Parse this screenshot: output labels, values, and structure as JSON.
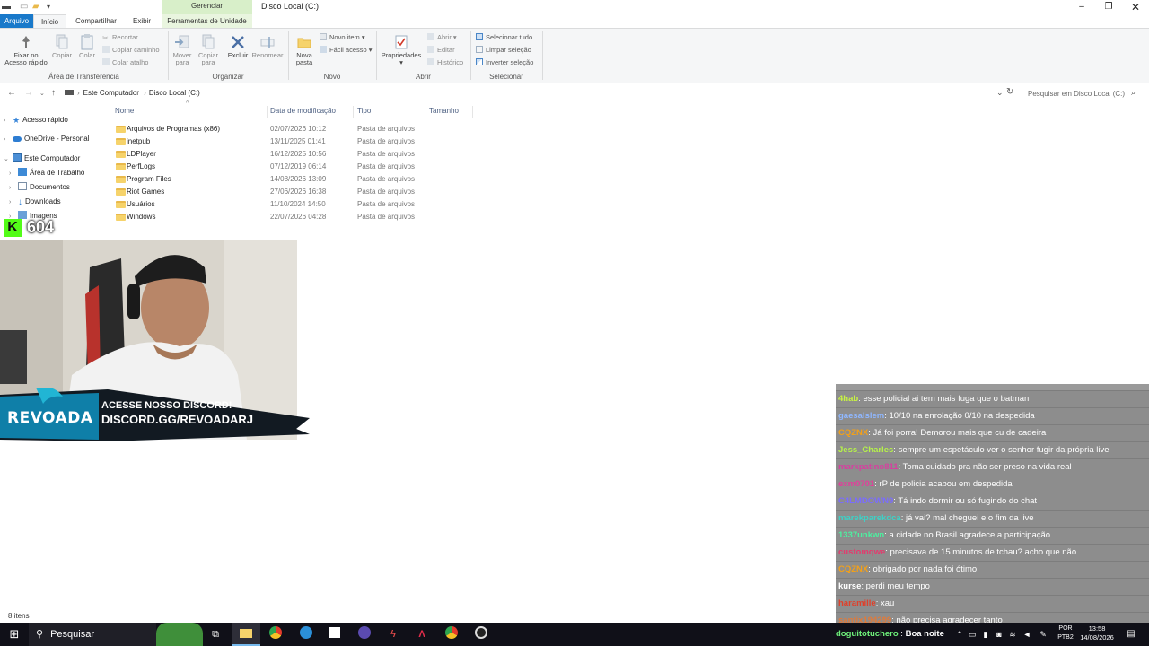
{
  "window": {
    "title": "Disco Local (C:)",
    "context_group": "Gerenciar"
  },
  "ribbon_tabs": [
    "Arquivo",
    "Início",
    "Compartilhar",
    "Exibir",
    "Ferramentas de Unidade"
  ],
  "ribbon": {
    "pin_label_1": "Fixar no",
    "pin_label_2": "Acesso rápido",
    "copy": "Copiar",
    "paste": "Colar",
    "cut": "Recortar",
    "copy_path": "Copiar caminho",
    "paste_shortcut": "Colar atalho",
    "move_to_1": "Mover",
    "move_to_2": "para",
    "copy_to_1": "Copiar",
    "copy_to_2": "para",
    "delete": "Excluir",
    "rename": "Renomear",
    "new_folder_1": "Nova",
    "new_folder_2": "pasta",
    "new_item": "Novo item",
    "easy_access": "Fácil acesso",
    "properties": "Propriedades",
    "open": "Abrir",
    "edit": "Editar",
    "history": "Histórico",
    "select_all": "Selecionar tudo",
    "select_none": "Limpar seleção",
    "invert_selection": "Inverter seleção",
    "groups": {
      "clipboard": "Área de Transferência",
      "organize": "Organizar",
      "new": "Novo",
      "open": "Abrir",
      "select": "Selecionar"
    }
  },
  "address": {
    "crumbs": [
      "Este Computador",
      "Disco Local (C:)"
    ],
    "separator": "›",
    "search_placeholder": "Pesquisar em Disco Local (C:)"
  },
  "nav_pane": {
    "quick_access": "Acesso rápido",
    "onedrive": "OneDrive - Personal",
    "this_pc": "Este Computador",
    "desktop": "Área de Trabalho",
    "documents": "Documentos",
    "downloads": "Downloads",
    "images": "Imagens"
  },
  "columns": {
    "name": "Nome",
    "modified": "Data de modificação",
    "type": "Tipo",
    "size": "Tamanho"
  },
  "files": [
    {
      "name": "Arquivos de Programas (x86)",
      "date": "02/07/2026 10:12",
      "type": "Pasta de arquivos"
    },
    {
      "name": "inetpub",
      "date": "13/11/2025 01:41",
      "type": "Pasta de arquivos"
    },
    {
      "name": "LDPlayer",
      "date": "16/12/2025 10:56",
      "type": "Pasta de arquivos"
    },
    {
      "name": "PerfLogs",
      "date": "07/12/2019 06:14",
      "type": "Pasta de arquivos"
    },
    {
      "name": "Program Files",
      "date": "14/08/2026 13:09",
      "type": "Pasta de arquivos"
    },
    {
      "name": "Riot Games",
      "date": "27/06/2026 16:38",
      "type": "Pasta de arquivos"
    },
    {
      "name": "Usuários",
      "date": "11/10/2024 14:50",
      "type": "Pasta de arquivos"
    },
    {
      "name": "Windows",
      "date": "22/07/2026 04:28",
      "type": "Pasta de arquivos"
    }
  ],
  "status": "8 itens",
  "overlay": {
    "viewer_badge": "K",
    "viewer_count": "604",
    "banner_brand": "REVOADA",
    "banner_line1": "ACESSE NOSSO DISCORD!",
    "banner_line2": "DISCORD.GG/REVOADARJ"
  },
  "chat": [
    {
      "user": "4hab",
      "color": "#c9f542",
      "text": "esse policial ai tem mais fuga que o batman"
    },
    {
      "user": "gaesalslem",
      "color": "#8fb7ff",
      "text": "10/10 na enrolação 0/10 na despedida"
    },
    {
      "user": "CQZNX",
      "color": "#f2a019",
      "text": "Já foi porra! Demorou mais que cu de cadeira"
    },
    {
      "user": "Jess_Charles",
      "color": "#b6f24a",
      "text": "sempre um espetáculo ver o senhor fugir da própria live"
    },
    {
      "user": "markpatino811",
      "color": "#d6409f",
      "text": "Toma cuidado pra não ser preso na vida real"
    },
    {
      "user": "exm0701",
      "color": "#e0409a",
      "text": "rP de policia acabou em despedida"
    },
    {
      "user": "C4LMDOWN9",
      "color": "#7a6cff",
      "text": "Tá indo dormir ou só fugindo do chat"
    },
    {
      "user": "marekparekdca",
      "color": "#3ed1c6",
      "text": "já vai? mal cheguei e o fim da live"
    },
    {
      "user": "1337unkwn",
      "color": "#4df0a0",
      "text": "a cidade no Brasil agradece a participação"
    },
    {
      "user": "customqwe",
      "color": "#e23b6e",
      "text": "precisava de 15 minutos de tchau? acho que não"
    },
    {
      "user": "CQZNX",
      "color": "#f2a019",
      "text": "obrigado por nada foi ótimo"
    },
    {
      "user": "kurse",
      "color": "#ffffff",
      "text": "perdi meu tempo"
    },
    {
      "user": "haramille",
      "color": "#e0402a",
      "text": "xau"
    },
    {
      "user": "santix194299",
      "color": "#e07a3a",
      "text": "não precisa agradecer tanto"
    }
  ],
  "taskbar": {
    "search": "Pesquisar",
    "notification_user": "doguitotuchero",
    "notification_text": "Boa noite",
    "lang_1": "POR",
    "lang_2": "PTB2",
    "time": "13:58",
    "date": "14/08/2026"
  }
}
